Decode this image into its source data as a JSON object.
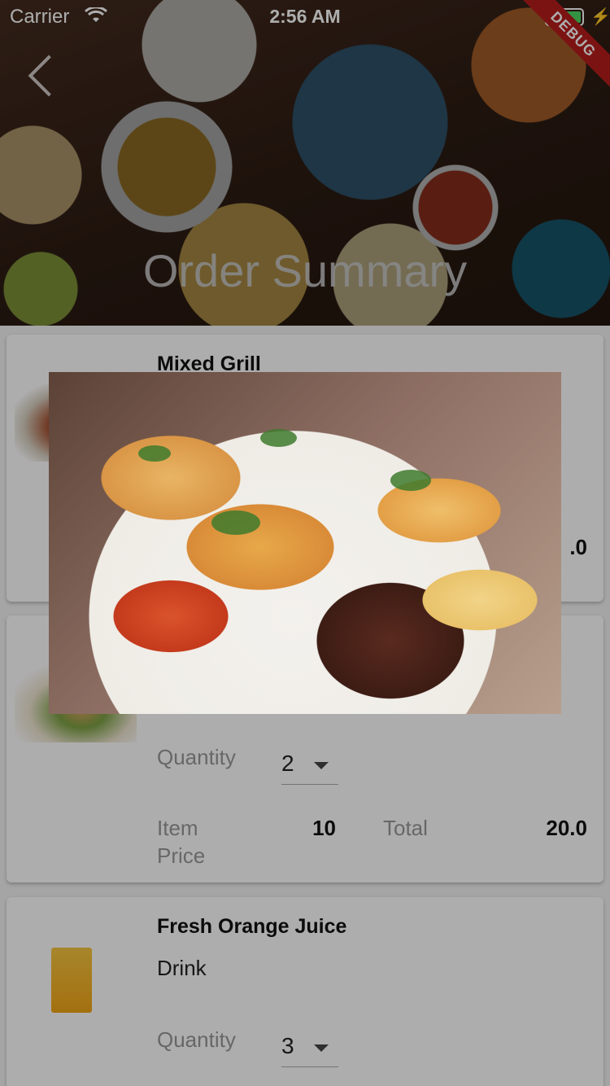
{
  "status_bar": {
    "carrier": "Carrier",
    "time": "2:56 AM"
  },
  "debug_banner": "DEBUG",
  "header": {
    "title": "Order Summary"
  },
  "items": [
    {
      "name": "Mixed Grill",
      "category": "",
      "quantity": "",
      "item_price_label": "",
      "item_price": "",
      "total_label": "",
      "total": ".0"
    },
    {
      "name": "",
      "category": "",
      "quantity_label": "Quantity",
      "quantity": "2",
      "item_price_label": "Item Price",
      "item_price": "10",
      "total_label": "Total",
      "total": "20.0"
    },
    {
      "name": "Fresh Orange Juice",
      "category": "Drink",
      "quantity_label": "Quantity",
      "quantity": "3"
    }
  ],
  "colors": {
    "debug": "#b71c1c",
    "battery": "#4cd964",
    "card": "#ffffff"
  }
}
